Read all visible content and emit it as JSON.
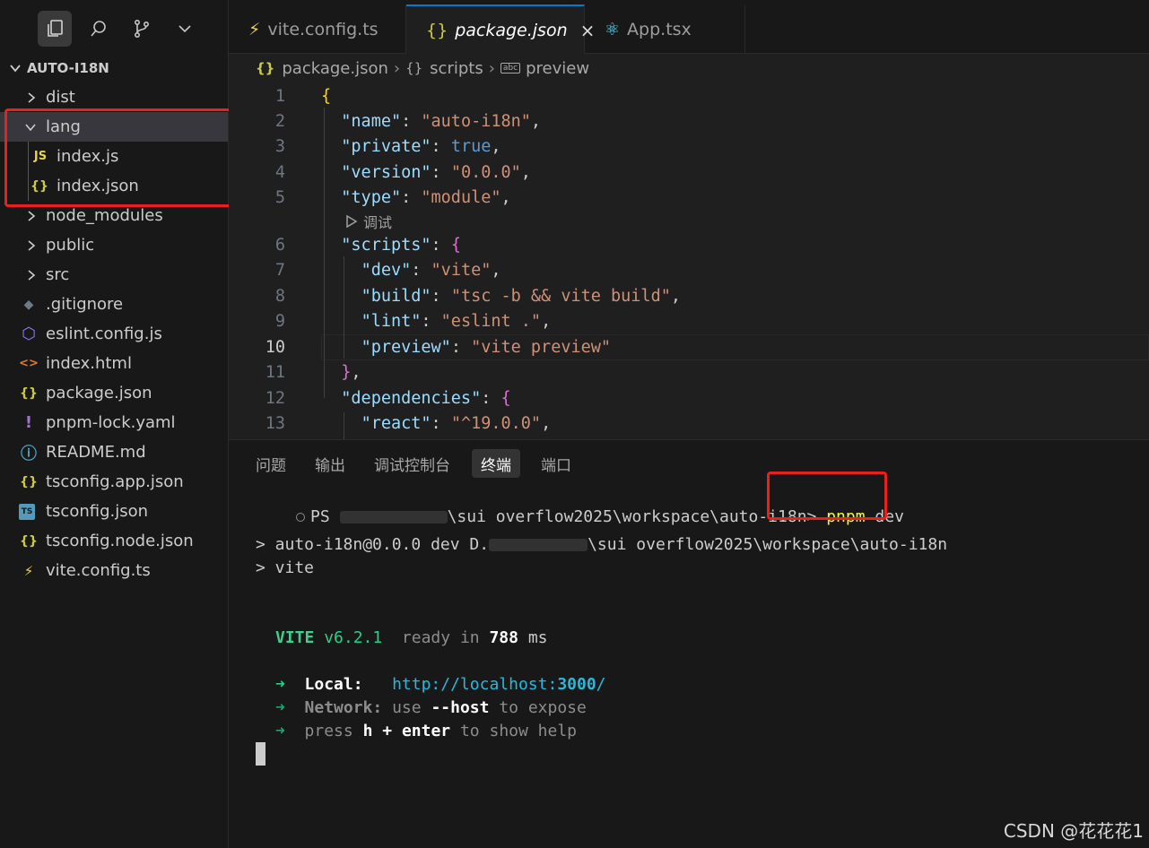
{
  "activity_bar": {
    "icons": [
      "explorer-icon",
      "search-icon",
      "source-control-icon",
      "chevron-down-icon"
    ]
  },
  "explorer": {
    "root_label": "AUTO-I18N",
    "items": [
      {
        "label": "dist",
        "type": "folder",
        "expanded": false
      },
      {
        "label": "lang",
        "type": "folder",
        "expanded": true
      },
      {
        "label": "index.js",
        "type": "js",
        "icon_text": "JS"
      },
      {
        "label": "index.json",
        "type": "json",
        "icon_text": "{}"
      },
      {
        "label": "node_modules",
        "type": "folder",
        "expanded": false
      },
      {
        "label": "public",
        "type": "folder",
        "expanded": false
      },
      {
        "label": "src",
        "type": "folder",
        "expanded": false
      },
      {
        "label": ".gitignore",
        "type": "git",
        "icon_text": "◆"
      },
      {
        "label": "eslint.config.js",
        "type": "eslint",
        "icon_text": "⬡"
      },
      {
        "label": "index.html",
        "type": "html",
        "icon_text": "<>"
      },
      {
        "label": "package.json",
        "type": "json",
        "icon_text": "{}"
      },
      {
        "label": "pnpm-lock.yaml",
        "type": "yaml",
        "icon_text": "!"
      },
      {
        "label": "README.md",
        "type": "info",
        "icon_text": "ⓘ"
      },
      {
        "label": "tsconfig.app.json",
        "type": "json",
        "icon_text": "{}"
      },
      {
        "label": "tsconfig.json",
        "type": "ts",
        "icon_text": "TS"
      },
      {
        "label": "tsconfig.node.json",
        "type": "json",
        "icon_text": "{}"
      },
      {
        "label": "vite.config.ts",
        "type": "vite",
        "icon_text": "⚡"
      }
    ]
  },
  "tabs": [
    {
      "label": "vite.config.ts",
      "icon_text": "⚡",
      "active": false
    },
    {
      "label": "package.json",
      "icon_text": "{}",
      "active": true,
      "close": "×"
    },
    {
      "label": "App.tsx",
      "icon_text": "⚛",
      "active": false
    }
  ],
  "breadcrumb": {
    "items": [
      "package.json",
      "scripts",
      "preview"
    ],
    "icons": [
      "{}",
      "{}",
      "abc"
    ],
    "separator": "›"
  },
  "editor": {
    "line_numbers": [
      "1",
      "2",
      "3",
      "4",
      "5",
      "6",
      "7",
      "8",
      "9",
      "10",
      "11",
      "12",
      "13"
    ],
    "current_line": "10",
    "codelens": "调试",
    "lines": [
      "{",
      "  \"name\": \"auto-i18n\",",
      "  \"private\": true,",
      "  \"version\": \"0.0.0\",",
      "  \"type\": \"module\",",
      "  \"scripts\": {",
      "    \"dev\": \"vite\",",
      "    \"build\": \"tsc -b && vite build\",",
      "    \"lint\": \"eslint .\",",
      "    \"preview\": \"vite preview\"",
      "  },",
      "  \"dependencies\": {",
      "    \"react\": \"^19.0.0\","
    ]
  },
  "panel": {
    "tabs": [
      "问题",
      "输出",
      "调试控制台",
      "终端",
      "端口"
    ],
    "active_tab": "终端"
  },
  "terminal": {
    "prompt_prefix": "PS",
    "prompt_path": "\\sui overflow2025\\workspace\\auto-i18n>",
    "command": "pnpm",
    "command_arg": "dev",
    "run_line_1_prefix": "> auto-i18n@0.0.0 dev D.",
    "run_line_1_suffix": "\\sui overflow2025\\workspace\\auto-i18n",
    "run_line_2": "> vite",
    "vite_name": "VITE",
    "vite_version": "v6.2.1",
    "ready_text": "ready in",
    "ready_ms": "788",
    "ready_unit": "ms",
    "arrow": "➜",
    "local_label": "Local:",
    "local_url_prefix": "http://localhost:",
    "local_url_port": "3000",
    "local_url_suffix": "/",
    "network_label": "Network:",
    "network_text_1": "use",
    "network_flag": "--host",
    "network_text_2": "to expose",
    "help_text_1": "press",
    "help_key_h": "h",
    "help_plus": "+",
    "help_key_enter": "enter",
    "help_text_2": "to show help"
  },
  "watermark": "CSDN @花花花1"
}
